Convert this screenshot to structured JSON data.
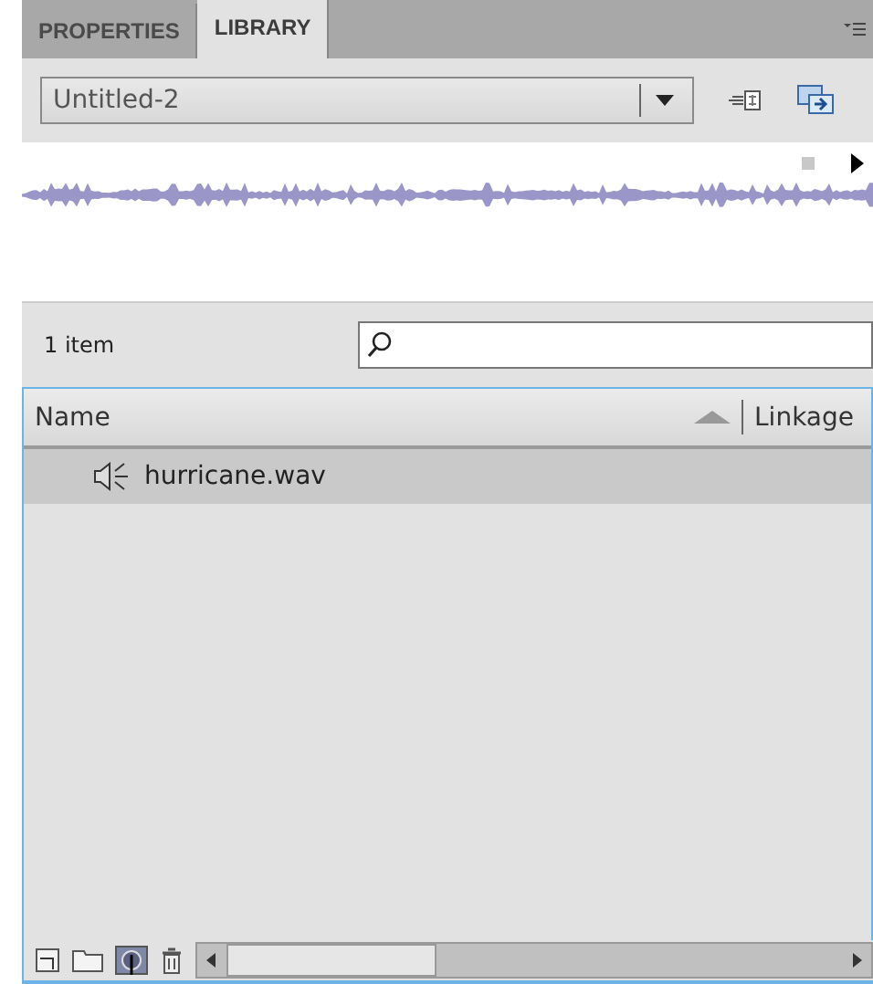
{
  "tabs": [
    {
      "label": "PROPERTIES",
      "selected": false
    },
    {
      "label": "LIBRARY",
      "selected": true
    }
  ],
  "document": {
    "value": "Untitled-2"
  },
  "item_count": "1 item",
  "columns": [
    {
      "label": "Name",
      "sorted": true
    },
    {
      "label": "Linkage",
      "sorted": false
    }
  ],
  "items": [
    {
      "name": "hurricane.wav",
      "kind": "sound",
      "selected": true
    }
  ]
}
